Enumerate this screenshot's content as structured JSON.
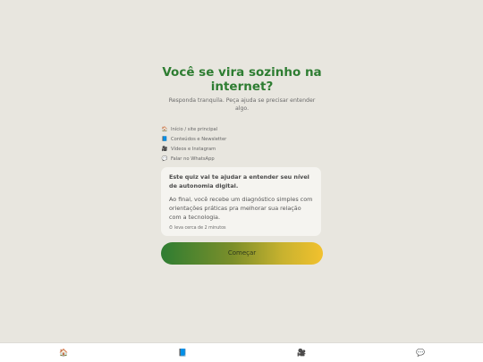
{
  "header": {
    "title": "Você se vira sozinho na internet?",
    "subtitle": "Responda tranquila. Peça ajuda se precisar entender algo."
  },
  "links": [
    {
      "icon": "home-icon",
      "glyph": "🏠",
      "label": "Início / site principal"
    },
    {
      "icon": "book-icon",
      "glyph": "📘",
      "label": "Conteúdos e Newsletter"
    },
    {
      "icon": "video-camera-icon",
      "glyph": "🎥",
      "label": "Vídeos e Instagram"
    },
    {
      "icon": "chat-bubble-icon",
      "glyph": "💬",
      "label": "Falar no WhatsApp"
    }
  ],
  "card": {
    "heading": "Este quiz vai te ajudar a entender seu nível de autonomia digital.",
    "body": "Ao final, você recebe um diagnóstico simples com orientações práticas pra melhorar sua relação com a tecnologia.",
    "time_icon": "⏱",
    "time": "leva cerca de 2 minutos"
  },
  "start_button": {
    "label": "Começar"
  },
  "bottom_nav": [
    {
      "icon": "home-icon",
      "glyph": "🏠"
    },
    {
      "icon": "book-icon",
      "glyph": "📘"
    },
    {
      "icon": "video-camera-icon",
      "glyph": "🎥"
    },
    {
      "icon": "chat-bubble-icon",
      "glyph": "💬"
    }
  ],
  "colors": {
    "background": "#e8e6df",
    "title_green": "#2e7d32",
    "button_gradient_start": "#2e7d32",
    "button_gradient_end": "#f2c12e",
    "card_bg": "#f5f4f0"
  }
}
